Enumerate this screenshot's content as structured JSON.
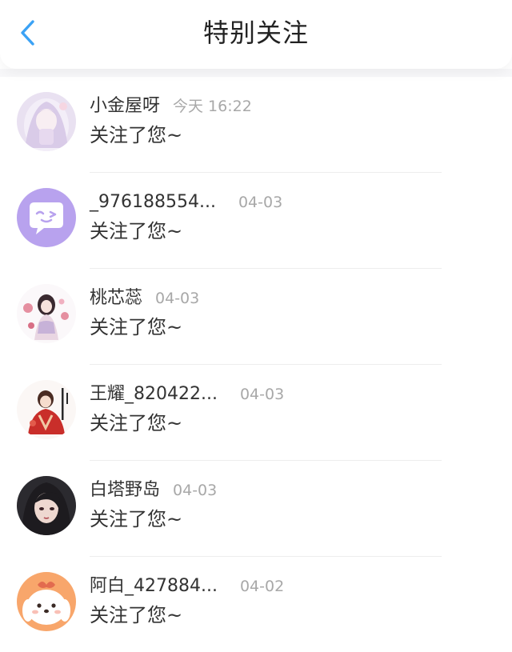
{
  "header": {
    "back_icon": "chevron-left-icon",
    "title": "特别关注",
    "accent_color": "#3ba2f5"
  },
  "items": [
    {
      "name": "小金屋呀",
      "time": "今天 16:22",
      "message": "关注了您~",
      "avatar": "anime-girl-avatar"
    },
    {
      "name": "_976188554...",
      "time": "04-03",
      "message": "关注了您~",
      "avatar": "purple-wink-avatar"
    },
    {
      "name": "桃芯蕊",
      "time": "04-03",
      "message": "关注了您~",
      "avatar": "flower-girl-avatar"
    },
    {
      "name": "王耀_820422...",
      "time": "04-03",
      "message": "关注了您~",
      "avatar": "red-robe-avatar"
    },
    {
      "name": "白塔野岛",
      "time": "04-03",
      "message": "关注了您~",
      "avatar": "dark-hair-avatar"
    },
    {
      "name": "阿白_427884...",
      "time": "04-02",
      "message": "关注了您~",
      "avatar": "cute-dog-avatar"
    }
  ]
}
